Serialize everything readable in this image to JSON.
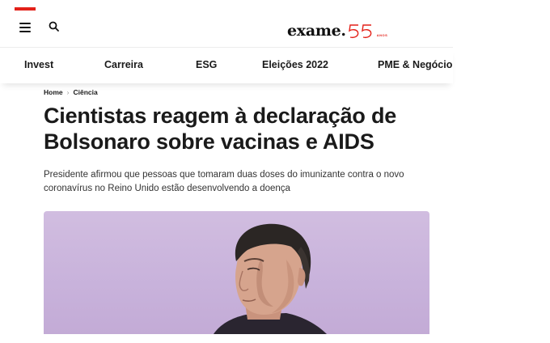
{
  "header": {
    "menu_icon": "hamburger-menu-icon",
    "search_icon": "search-icon",
    "logo": {
      "word": "exame.",
      "number": "55",
      "sub": "ANOS",
      "accent": "#e32119"
    }
  },
  "nav": {
    "items": [
      "Invest",
      "Carreira",
      "ESG",
      "Eleições 2022",
      "PME & Negócio"
    ]
  },
  "breadcrumb": {
    "home": "Home",
    "section": "Ciência"
  },
  "article": {
    "title": "Cientistas reagem à declaração de Bolsonaro sobre vacinas e AIDS",
    "subtitle": "Presidente afirmou que pessoas que tomaram duas doses do imunizante contra o novo coronavírus no Reino Unido estão desenvolvendo a doença",
    "hero_background": "#cbb5dd"
  },
  "colors": {
    "accent": "#e32119",
    "text": "#1a1a1a"
  }
}
